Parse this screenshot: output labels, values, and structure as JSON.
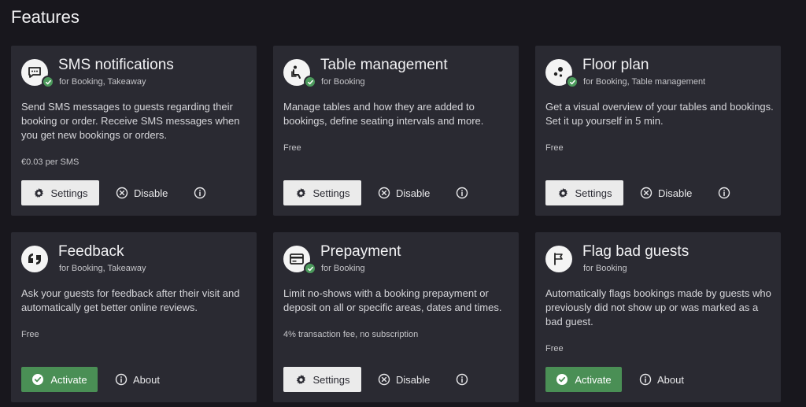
{
  "page": {
    "title": "Features"
  },
  "cards": [
    {
      "title": "SMS notifications",
      "subtitle": "for Booking, Takeaway",
      "description": "Send SMS messages to guests regarding their booking or order. Receive SMS messages when you get new bookings or orders.",
      "price": "€0.03 per SMS",
      "icon": "chat-icon",
      "active": true,
      "primary_label": "Settings",
      "secondary_label": "Disable"
    },
    {
      "title": "Table management",
      "subtitle": "for Booking",
      "description": "Manage tables and how they are added to bookings, define seating intervals and more.",
      "price": "Free",
      "icon": "seat-icon",
      "active": true,
      "primary_label": "Settings",
      "secondary_label": "Disable"
    },
    {
      "title": "Floor plan",
      "subtitle": "for Booking, Table management",
      "description": "Get a visual overview of your tables and bookings. Set it up yourself in 5 min.",
      "price": "Free",
      "icon": "floor-plan-icon",
      "active": true,
      "primary_label": "Settings",
      "secondary_label": "Disable"
    },
    {
      "title": "Feedback",
      "subtitle": "for Booking, Takeaway",
      "description": "Ask your guests for feedback after their visit and automatically get better online reviews.",
      "price": "Free",
      "icon": "quote-icon",
      "active": false,
      "primary_label": "Activate",
      "secondary_label": "About"
    },
    {
      "title": "Prepayment",
      "subtitle": "for Booking",
      "description": "Limit no-shows with a booking prepayment or deposit on all or specific areas, dates and times.",
      "price": "4% transaction fee, no subscription",
      "icon": "credit-card-icon",
      "active": true,
      "primary_label": "Settings",
      "secondary_label": "Disable"
    },
    {
      "title": "Flag bad guests",
      "subtitle": "for Booking",
      "description": "Automatically flags bookings made by guests who previously did not show up or was marked as a bad guest.",
      "price": "Free",
      "icon": "flag-icon",
      "active": false,
      "primary_label": "Activate",
      "secondary_label": "About"
    }
  ],
  "colors": {
    "background": "#18171d",
    "card": "#2a2a32",
    "accent_green": "#4a8f55",
    "button_light": "#ebebeb"
  }
}
